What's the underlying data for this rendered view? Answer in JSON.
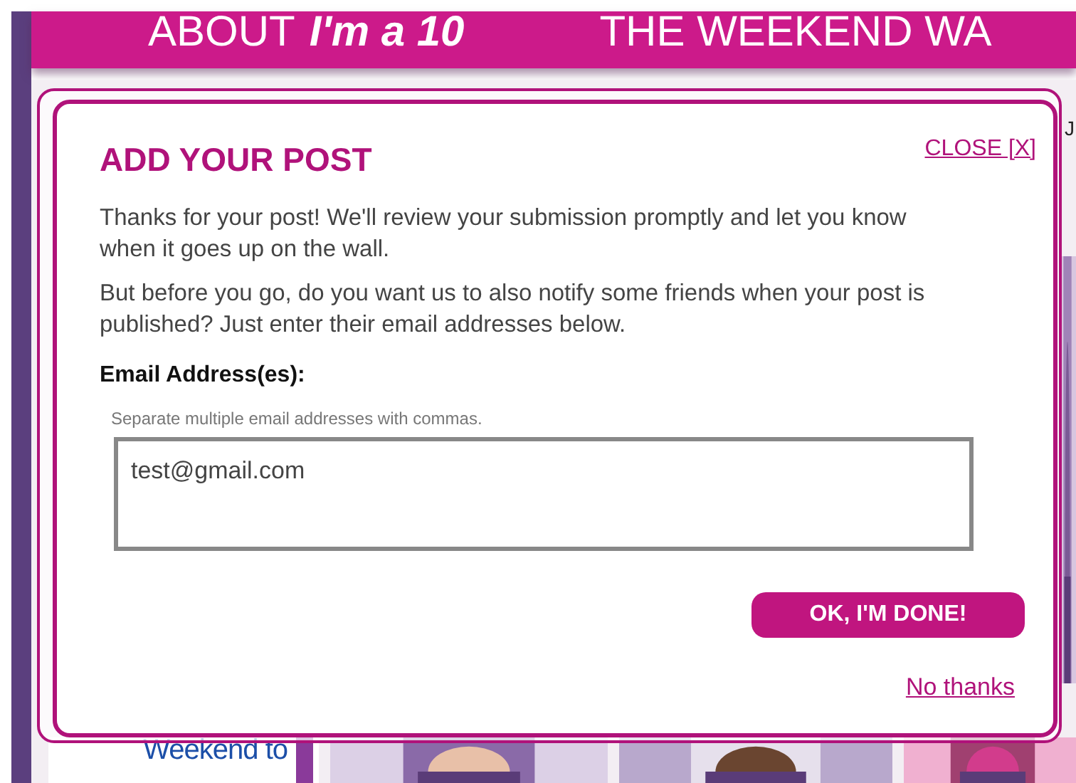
{
  "header": {
    "about": "ABOUT",
    "brand": "I'm a 10",
    "next": "THE WEEKEND WA"
  },
  "side_letter": "J",
  "tiles": [
    {
      "kind": "text",
      "lines": [
        "Weekend to"
      ]
    },
    {
      "kind": "picture"
    },
    {
      "kind": "picture"
    },
    {
      "kind": "picture"
    }
  ],
  "modal": {
    "title": "ADD YOUR POST",
    "close": "CLOSE [X]",
    "paragraphs": [
      "Thanks for your post! We'll review your submission promptly and let you know when it goes up on the wall.",
      "But before you go, do you want us to also notify some friends when your post is published? Just enter their email addresses below."
    ],
    "email_label": "Email Address(es):",
    "hint": "Separate multiple email addresses with commas.",
    "email_value": "test@gmail.com",
    "done_button": "OK, I'M DONE!",
    "no_thanks": "No thanks"
  }
}
